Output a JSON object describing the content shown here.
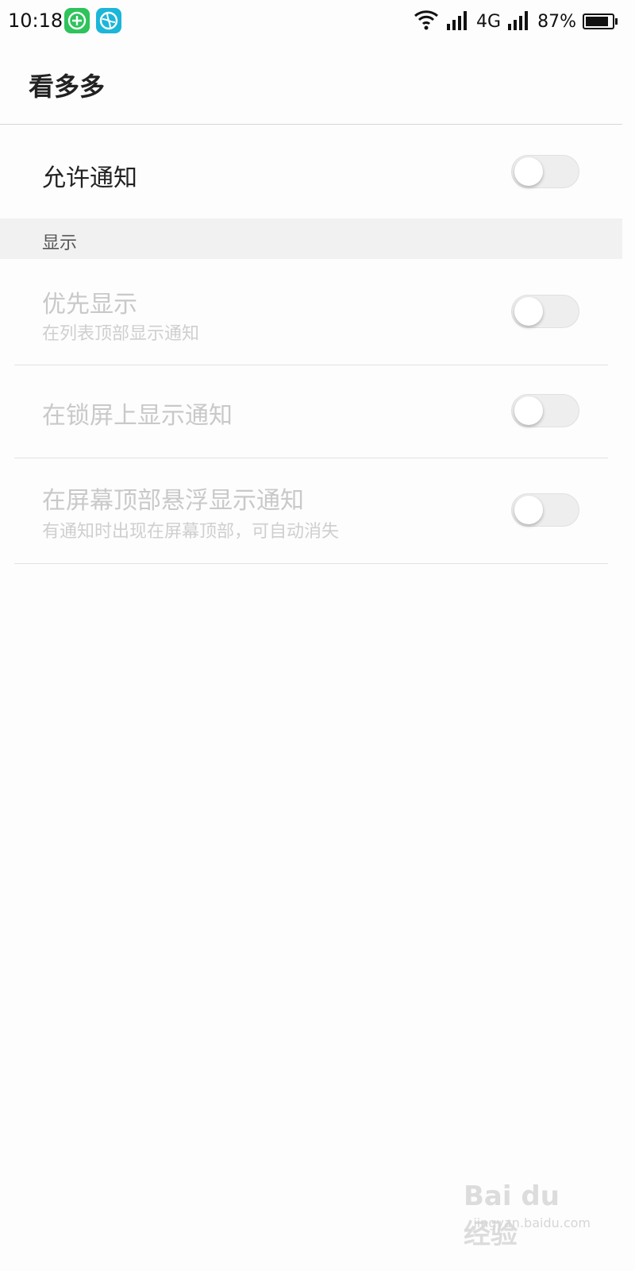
{
  "status_bar": {
    "time": "10:18",
    "network": "4G",
    "battery_percent": "87%",
    "battery_level": 0.87,
    "app_icons": [
      "green-plus-app-icon",
      "blue-ball-app-icon"
    ],
    "icons": [
      "wifi-icon",
      "signal-icon",
      "signal-icon",
      "battery-icon"
    ]
  },
  "header": {
    "title": "看多多"
  },
  "main_toggle": {
    "label": "允许通知",
    "enabled": false
  },
  "section": {
    "title": "显示"
  },
  "settings": [
    {
      "label": "优先显示",
      "sublabel": "在列表顶部显示通知",
      "enabled": false
    },
    {
      "label": "在锁屏上显示通知",
      "sublabel": "",
      "enabled": false
    },
    {
      "label": "在屏幕顶部悬浮显示通知",
      "sublabel": "有通知时出现在屏幕顶部，可自动消失",
      "enabled": false
    }
  ],
  "watermark": {
    "main": "Bai du 经验",
    "sub": "jingyan.baidu.com"
  },
  "colors": {
    "accent_green": "#2ec35b",
    "accent_blue": "#1cb6d8",
    "section_bg": "#f1f1f1"
  }
}
